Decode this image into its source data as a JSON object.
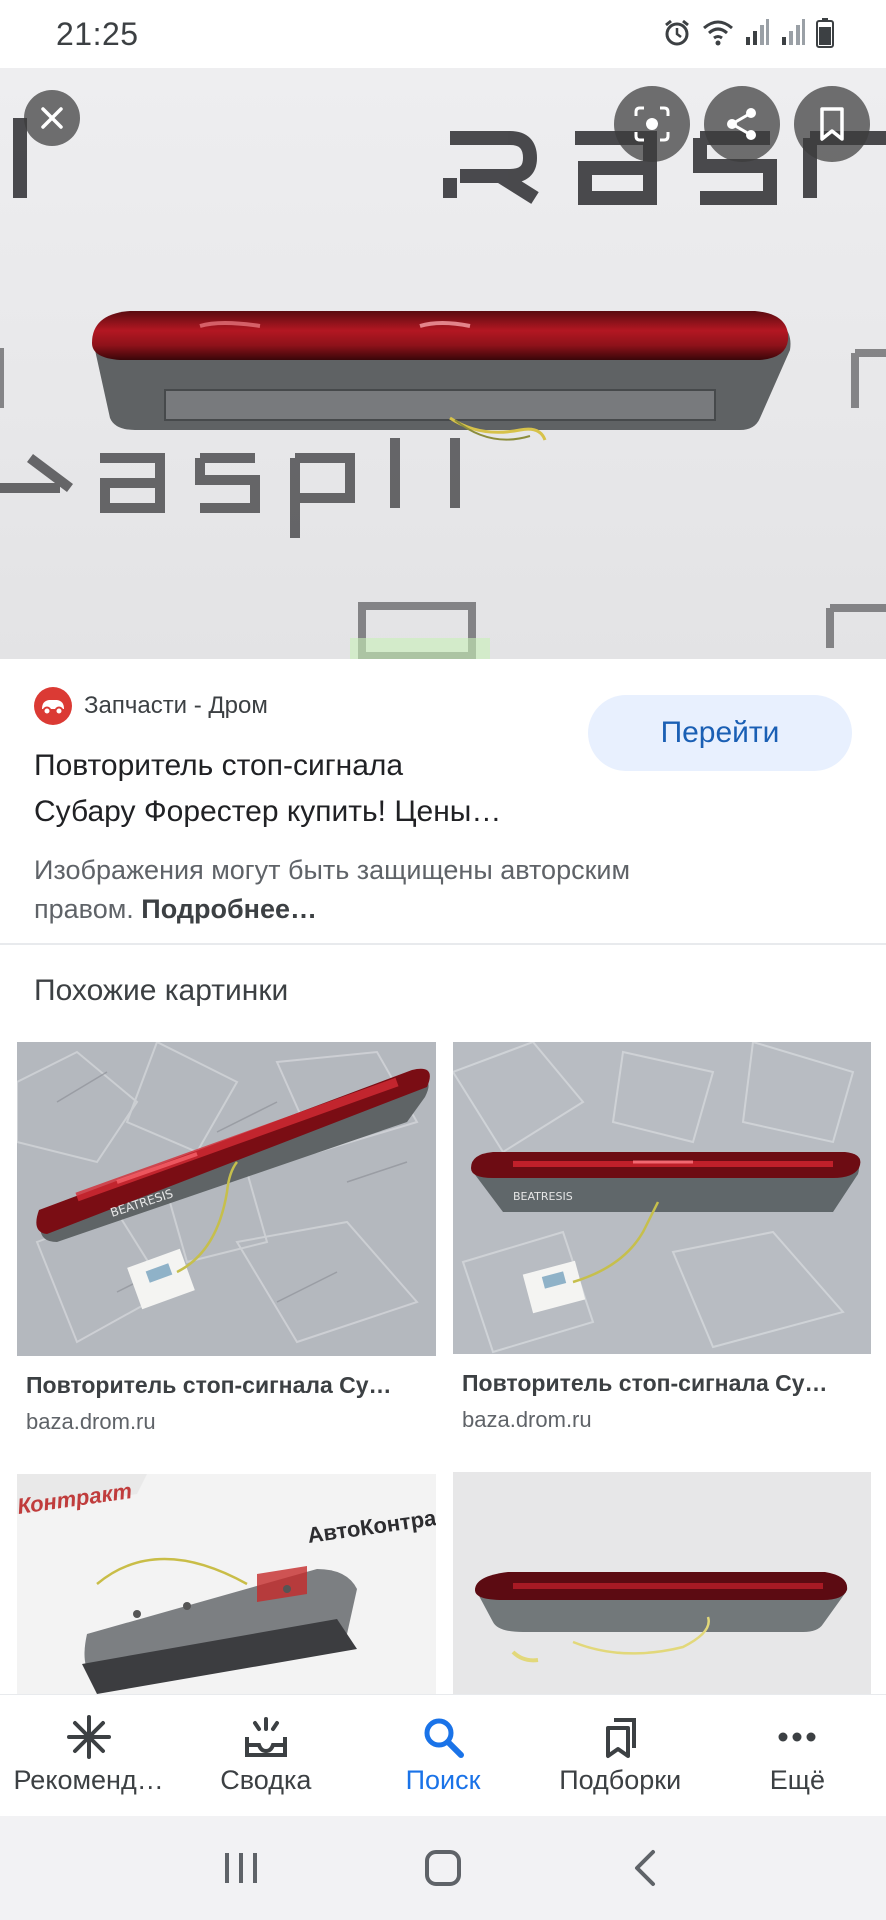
{
  "status_bar": {
    "time": "21:25",
    "icons": [
      "alarm-icon",
      "wifi-icon",
      "signal-icon",
      "signal-icon",
      "battery-icon"
    ]
  },
  "hero": {
    "watermark_text": "RASPIL",
    "close_icon": "close-icon",
    "actions": [
      "lens-icon",
      "share-icon",
      "bookmark-icon"
    ]
  },
  "source": {
    "name": "Запчасти - Дром",
    "logo_color": "#db3a34",
    "go_button": "Перейти",
    "title_line1": "Повторитель стоп-сигнала",
    "title_line2": "Субару Форестер купить! Цены…",
    "copyright_text": "Изображения могут быть защищены авторским",
    "copyright_text2": "правом.",
    "copyright_link": "Подробнее…"
  },
  "similar": {
    "heading": "Похожие картинки",
    "items": [
      {
        "title": "Повторитель стоп-сигнала Су…",
        "domain": "baza.drom.ru"
      },
      {
        "title": "Повторитель стоп-сигнала Су…",
        "domain": "baza.drom.ru"
      },
      {
        "watermark": "Контракт",
        "watermark2": "АвтоКонтра"
      },
      {}
    ]
  },
  "bottom_nav": {
    "items": [
      {
        "label": "Рекоменд…",
        "icon": "asterisk-icon"
      },
      {
        "label": "Сводка",
        "icon": "inbox-icon"
      },
      {
        "label": "Поиск",
        "icon": "search-icon",
        "active": true
      },
      {
        "label": "Подборки",
        "icon": "collections-icon"
      },
      {
        "label": "Ещё",
        "icon": "more-icon"
      }
    ]
  },
  "colors": {
    "accent": "#1a73e8",
    "button_bg": "#e8f0fe",
    "lamp_red": "#a3121c"
  }
}
